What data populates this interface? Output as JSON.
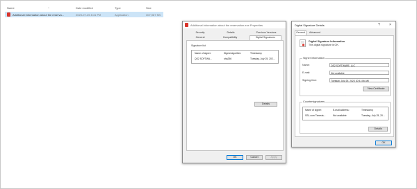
{
  "explorer": {
    "columns": [
      "Name",
      "Date modified",
      "Type",
      "Size"
    ],
    "file": {
      "icon": "pdf-file-icon",
      "name": "Additional information about the reserva...",
      "date": "2023-07-25 8:41 PM",
      "type": "Application",
      "size": "307,987 KB"
    }
  },
  "properties": {
    "title": "Additional information about the reservation.exe Properties",
    "tabs_row1": [
      "Security",
      "Details",
      "Previous Versions"
    ],
    "tabs_row2": [
      "General",
      "Compatibility",
      "Digital Signatures"
    ],
    "sig_list_label": "Signature list",
    "columns": [
      "Name of signer:",
      "Digest algorithm",
      "Timestamp"
    ],
    "row": [
      "QS2 SOFTWA...",
      "sha256",
      "Tuesday, July 25, 202..."
    ],
    "details_button": "Details",
    "ok_button": "OK",
    "cancel_button": "Cancel",
    "apply_button": "Apply"
  },
  "sigdetails": {
    "title": "Digital Signature Details",
    "help_icon": "?",
    "close_icon": "×",
    "tabs": [
      "General",
      "Advanced"
    ],
    "heading": "Digital Signature Information",
    "status": "This digital signature is OK.",
    "signer_legend": "Signer information",
    "name_label": "Name:",
    "name_value": "QS2 SOFTWARE, LLC",
    "email_label": "E-mail:",
    "email_value": "Not available",
    "time_label": "Signing time:",
    "time_value": "Tuesday, July 25, 2023 10:41:06 AM",
    "view_cert_button": "View Certificate",
    "counter_legend": "Countersignatures",
    "counter_columns": [
      "Name of signer:",
      "E-mail address:",
      "Timestamp"
    ],
    "counter_row": [
      "SSL.com Timesta...",
      "Not available",
      "Tuesday, July 25, 20..."
    ],
    "details_button": "Details",
    "ok_button": "OK"
  }
}
